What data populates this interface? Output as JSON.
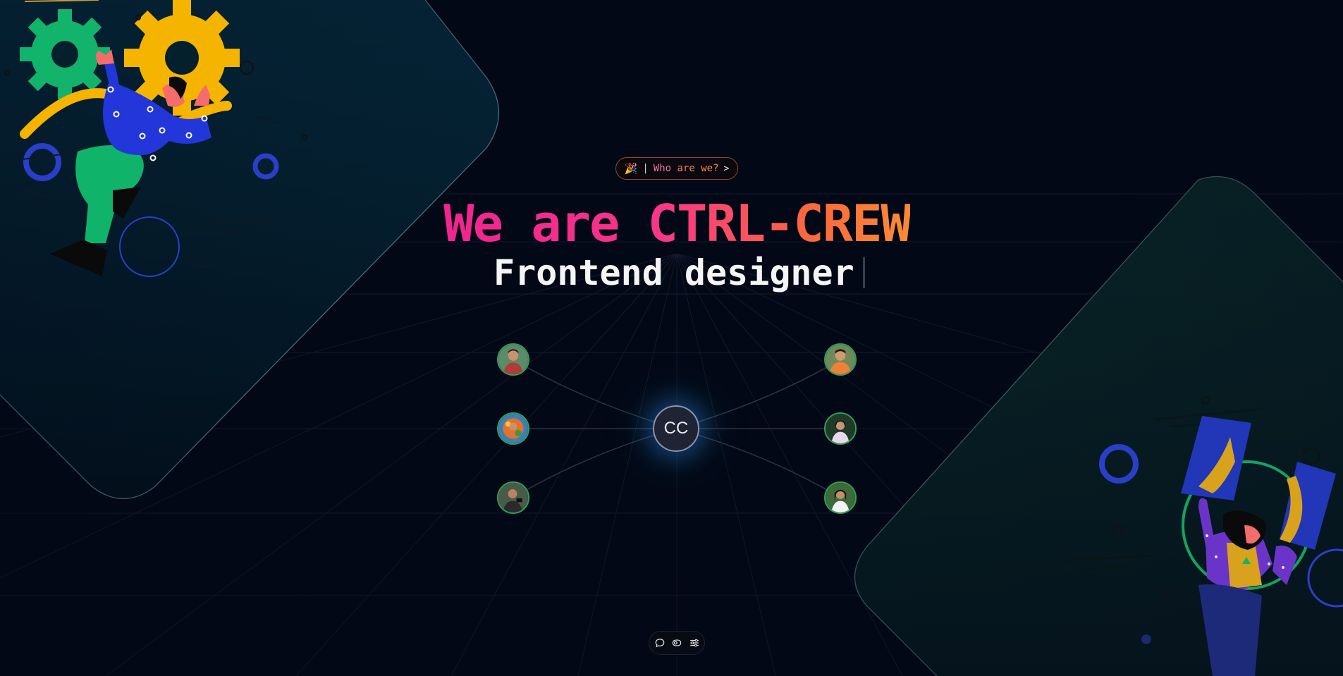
{
  "badge": {
    "emoji": "🎉",
    "divider": "|",
    "label": "Who are we?",
    "chevron": ">"
  },
  "hero": {
    "title": "We are CTRL-CREW",
    "typed_role": "Frontend designer"
  },
  "network": {
    "center_label": "CC",
    "members": [
      {
        "name": "member-1"
      },
      {
        "name": "member-2"
      },
      {
        "name": "member-3"
      },
      {
        "name": "member-4"
      },
      {
        "name": "member-5"
      },
      {
        "name": "member-6"
      }
    ]
  },
  "dock": {
    "icons": [
      "chat-icon",
      "eye-icon",
      "sliders-icon"
    ]
  },
  "colors": {
    "background": "#030817",
    "accent_pink": "#f0258e",
    "accent_orange": "#fb8a34",
    "avatar_ring": "#2fa05a"
  }
}
